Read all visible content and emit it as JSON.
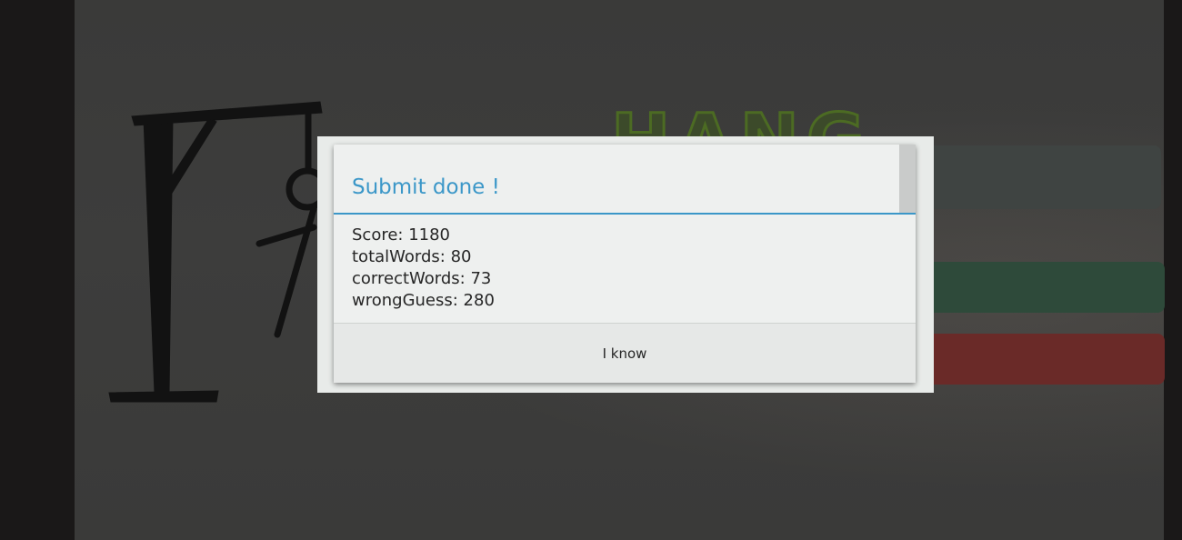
{
  "background": {
    "app_title": "HANG"
  },
  "dialog": {
    "title": "Submit done !",
    "lines": [
      "Score: 1180",
      "totalWords: 80",
      "correctWords: 73",
      "wrongGuess: 280"
    ],
    "ok_label": "I know"
  },
  "colors": {
    "title_accent": "#3b97c8",
    "dialog_bg": "#eef0ef",
    "screen_bg": "#3a3a39"
  }
}
